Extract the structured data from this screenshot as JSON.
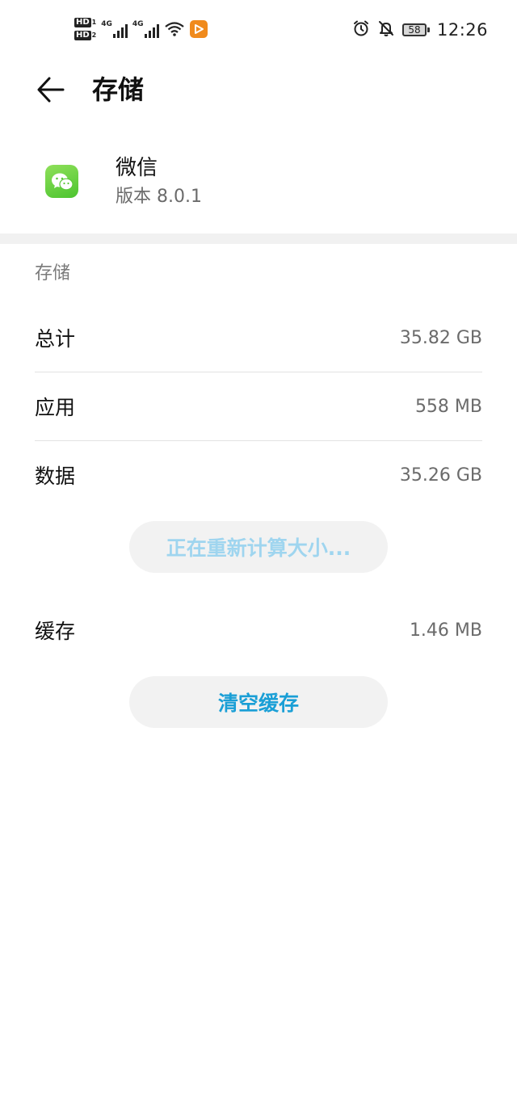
{
  "status_bar": {
    "sim1_label": "HD",
    "sim1_num": "1",
    "sim2_label": "HD",
    "sim2_num": "2",
    "network1": "4G",
    "network2": "4G",
    "battery": "58",
    "time": "12:26",
    "icons": [
      "hd-icon",
      "signal-icon",
      "wifi-icon",
      "app-notification-icon",
      "alarm-icon",
      "mute-bell-icon",
      "battery-icon"
    ]
  },
  "header": {
    "title": "存储"
  },
  "app": {
    "name": "微信",
    "version": "版本 8.0.1",
    "icon": "wechat-icon",
    "icon_color": "#5BC83A"
  },
  "storage": {
    "section_label": "存储",
    "rows": [
      {
        "label": "总计",
        "value": "35.82 GB"
      },
      {
        "label": "应用",
        "value": "558 MB"
      },
      {
        "label": "数据",
        "value": "35.26 GB"
      }
    ],
    "recalc_button": "正在重新计算大小...",
    "cache": {
      "label": "缓存",
      "value": "1.46 MB"
    },
    "clear_cache_button": "清空缓存"
  },
  "colors": {
    "accent": "#1A9FD6",
    "accent_disabled": "#9FD5EF",
    "button_bg": "#F2F2F2"
  }
}
